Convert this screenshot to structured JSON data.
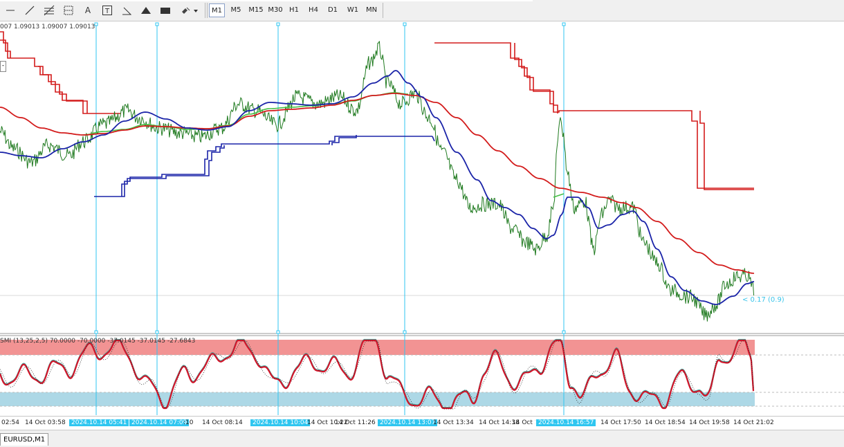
{
  "toolbar": {
    "tools": [
      {
        "name": "crosshair-icon"
      },
      {
        "name": "trendline-icon"
      },
      {
        "name": "fibonacci-icon"
      },
      {
        "name": "fibo-grid-icon"
      },
      {
        "name": "text-icon",
        "label": "A"
      },
      {
        "name": "text-label-icon"
      },
      {
        "name": "angle-icon"
      },
      {
        "name": "triangle-icon"
      },
      {
        "name": "rectangle-icon"
      },
      {
        "name": "shapes-menu-icon"
      }
    ],
    "timeframes": [
      "M1",
      "M5",
      "M15",
      "M30",
      "H1",
      "H4",
      "D1",
      "W1",
      "MN"
    ],
    "active_timeframe": "M1"
  },
  "chart": {
    "ohlc_text": "007 1.09013 1.09007 1.09013",
    "indicator_label": "SMI (13,25,2,5) 70.0000 -70.0000 -37.0145 -37.0145 -27.6843",
    "price_label": "< 0.17 (0.9)",
    "left_box_text": "-",
    "colors": {
      "price": "#1f7a1f",
      "ma_blue": "#1a23a8",
      "ma_red": "#d31b1b",
      "ma_green": "#45c045",
      "vline": "#2fc6f0",
      "overbought_zone": "#f08080",
      "oversold_zone": "#add8e6",
      "smi_main": "#d3152a",
      "smi_signal": "#3aa59a"
    },
    "smi_levels": [
      70,
      -70
    ]
  },
  "time_axis": {
    "labels": [
      "02:54",
      "14 Oct 03:58",
      "14 Oct 08:14",
      "14 Oct 10:22",
      "14 Oct 11:26",
      "14 Oct 13:34",
      "14 Oct 14:38",
      "14 Oct 17:50",
      "14 Oct 18:54",
      "14 Oct 19:58",
      "14 Oct 21:02"
    ],
    "highlighted": [
      "2024.10.14 05:41",
      "2024.10.14 07:09",
      "2024.10.14 10:04",
      "2024.10.14 13:07",
      "2024.10.14 16:57"
    ],
    "fragments": [
      ":10",
      "14 Oct 1"
    ]
  },
  "bottom": {
    "symbol_tab": "EURUSD,M1"
  }
}
